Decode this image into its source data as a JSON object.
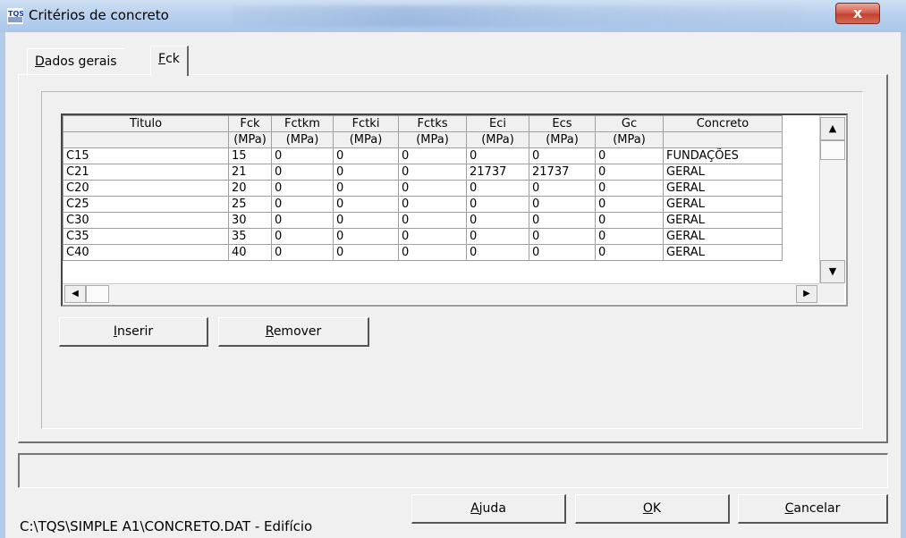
{
  "window": {
    "title": "Critérios de concreto",
    "app_icon": "tqs-logo-icon",
    "close_label": "x"
  },
  "tabs": [
    {
      "label": "Dados gerais",
      "hotkey": "D",
      "rest": "ados gerais",
      "selected": false
    },
    {
      "label": "Fck",
      "hotkey": "F",
      "rest": "ck",
      "selected": true
    }
  ],
  "table": {
    "columns": [
      "Titulo",
      "Fck",
      "Fctkm",
      "Fctki",
      "Fctks",
      "Eci",
      "Ecs",
      "Gc",
      "Concreto"
    ],
    "units": [
      "",
      "(MPa)",
      "(MPa)",
      "(MPa)",
      "(MPa)",
      "(MPa)",
      "(MPa)",
      "(MPa)",
      ""
    ],
    "rows": [
      [
        "C15",
        "15",
        "0",
        "0",
        "0",
        "0",
        "0",
        "0",
        "FUNDAÇÕES"
      ],
      [
        "C21",
        "21",
        "0",
        "0",
        "0",
        "21737",
        "21737",
        "0",
        "GERAL"
      ],
      [
        "C20",
        "20",
        "0",
        "0",
        "0",
        "0",
        "0",
        "0",
        "GERAL"
      ],
      [
        "C25",
        "25",
        "0",
        "0",
        "0",
        "0",
        "0",
        "0",
        "GERAL"
      ],
      [
        "C30",
        "30",
        "0",
        "0",
        "0",
        "0",
        "0",
        "0",
        "GERAL"
      ],
      [
        "C35",
        "35",
        "0",
        "0",
        "0",
        "0",
        "0",
        "0",
        "GERAL"
      ],
      [
        "C40",
        "40",
        "0",
        "0",
        "0",
        "0",
        "0",
        "0",
        "GERAL"
      ]
    ]
  },
  "buttons": {
    "inserir": {
      "label": "Inserir",
      "hotkey": "I",
      "rest": "nserir"
    },
    "remover": {
      "label": "Remover",
      "hotkey": "R",
      "rest": "emover"
    },
    "ajuda": {
      "label": "Ajuda",
      "hotkey": "A",
      "rest": "juda"
    },
    "ok": {
      "label": "OK",
      "hotkey": "O",
      "rest": "K"
    },
    "cancelar": {
      "label": "Cancelar",
      "hotkey": "C",
      "rest": "ancelar"
    }
  },
  "status": {
    "path": "C:\\TQS\\SIMPLE A1\\CONCRETO.DAT - Edifício"
  },
  "colors": {
    "titlebar": "#b9d1ee",
    "close_button": "#c94c38",
    "dialog_bg": "#f0f0f0"
  }
}
